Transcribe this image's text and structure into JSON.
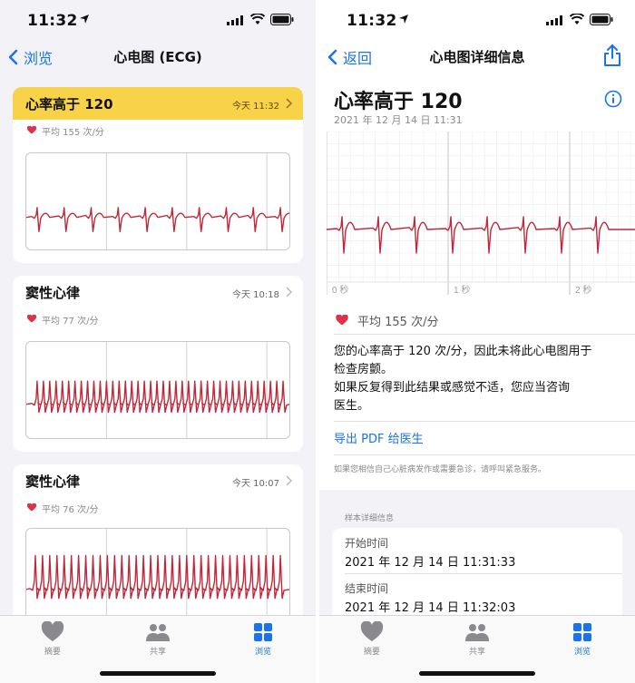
{
  "status": {
    "time": "11:32"
  },
  "left": {
    "nav": {
      "back_label": "浏览",
      "title": "心电图 (ECG)"
    },
    "records": [
      {
        "title": "心率高于 120",
        "time": "今天 11:32",
        "avg": "平均 155 次/分",
        "highlight": true
      },
      {
        "title": "窦性心律",
        "time": "今天 10:18",
        "avg": "平均 77 次/分",
        "highlight": false
      },
      {
        "title": "窦性心律",
        "time": "今天 10:07",
        "avg": "平均 76 次/分",
        "highlight": false
      }
    ]
  },
  "right": {
    "nav": {
      "back_label": "返回",
      "title": "心电图详细信息"
    },
    "title": "心率高于 120",
    "datetime": "2021 年 12 月 14 日 11:31",
    "axis": {
      "t0": "0 秒",
      "t1": "1 秒",
      "t2": "2 秒"
    },
    "avg": "平均 155 次/分",
    "warning_lines": [
      "您的心率高于 120 次/分，因此未将此心电图用于",
      "检查房颤。",
      "如果反复得到此结果或感觉不适，您应当咨询",
      "医生。"
    ],
    "export_label": "导出 PDF 给医生",
    "notice": "如果您相信自己心脏病发作或需要急诊，请呼叫紧急服务。",
    "sample_section_label": "样本详细信息",
    "start_label": "开始时间",
    "start_value": "2021 年 12 月 14 日 11:31:33",
    "end_label": "结束时间",
    "end_value": "2021 年 12 月 14 日 11:32:03"
  },
  "tabs": [
    {
      "label": "摘要",
      "icon": "heart-icon",
      "active": false
    },
    {
      "label": "共享",
      "icon": "people-icon",
      "active": false
    },
    {
      "label": "浏览",
      "icon": "grid-icon",
      "active": true
    }
  ],
  "colors": {
    "accent": "#1a73e8",
    "highlight": "#f8d248",
    "ecg": "#c0283a",
    "heart": "#e0304a"
  }
}
